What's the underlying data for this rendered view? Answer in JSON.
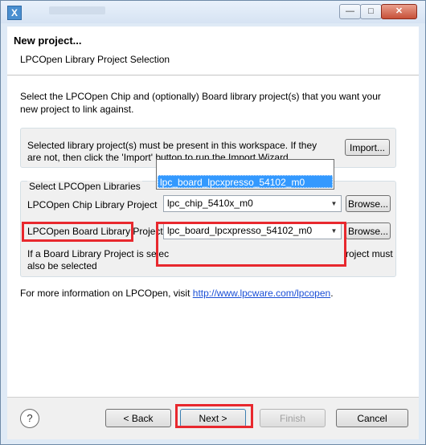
{
  "window": {
    "app_icon": "X",
    "controls": {
      "minimize": "—",
      "maximize": "□",
      "close": "✕"
    }
  },
  "header": {
    "title": "New project...",
    "subtitle": "LPCOpen Library Project Selection"
  },
  "main": {
    "description": "Select the LPCOpen Chip and (optionally) Board library project(s) that you want your new project to link against.",
    "notice": "Selected library project(s) must be present in this workspace. If they are not, then click the 'Import' button to run the Import Wizard",
    "import_label": "Import...",
    "group_title": "Select LPCOpen Libraries",
    "chip_label": "LPCOpen Chip Library Project",
    "chip_value": "lpc_chip_5410x_m0",
    "chip_browse": "Browse...",
    "board_label": "LPCOpen Board Library Project",
    "board_value": "lpc_board_lpcxpresso_54102_m0",
    "board_browse": "Browse...",
    "board_note_left": "If a Board Library Project is selec",
    "board_note_right": "roject must",
    "board_note_line2": "also be selected",
    "dropdown_option": "lpc_board_lpcxpresso_54102_m0",
    "more_info_text": "For more information on LPCOpen, visit",
    "more_info_link": "http://www.lpcware.com/lpcopen",
    "more_info_suffix": "."
  },
  "footer": {
    "help": "?",
    "back": "< Back",
    "next": "Next >",
    "finish": "Finish",
    "cancel": "Cancel"
  },
  "colors": {
    "highlight": "#e8282e",
    "selection": "#3399ff",
    "link": "#1a4fd6"
  }
}
